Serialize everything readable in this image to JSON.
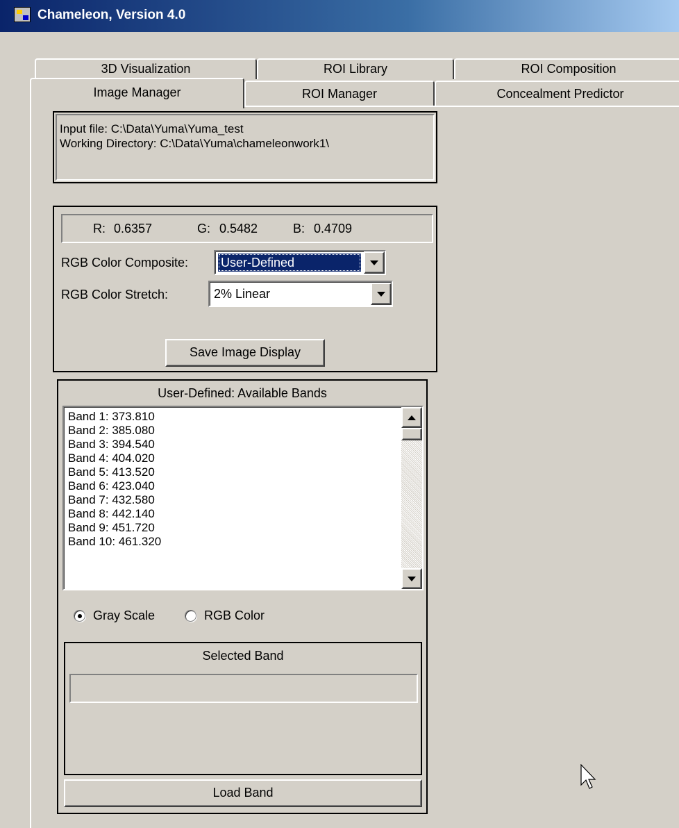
{
  "window": {
    "title": "Chameleon, Version 4.0",
    "icon": "app-icon"
  },
  "tabs": {
    "back_row": [
      "3D Visualization",
      "ROI Library",
      "ROI Composition"
    ],
    "front_row": [
      "Image Manager",
      "ROI Manager",
      "Concealment Predictor"
    ],
    "active": "Image Manager"
  },
  "file_info": {
    "input_file": "Input file: C:\\Data\\Yuma\\Yuma_test",
    "working_directory": "Working Directory: C:\\Data\\Yuma\\chameleonwork1\\"
  },
  "rgb_readout": {
    "r_label": "R:",
    "r_value": "0.6357",
    "g_label": "G:",
    "g_value": "0.5482",
    "b_label": "B:",
    "b_value": "0.4709"
  },
  "composite": {
    "label": "RGB Color Composite:",
    "value": "User-Defined"
  },
  "stretch": {
    "label": "RGB Color Stretch:",
    "value": "2% Linear"
  },
  "save_button": "Save Image Display",
  "bands": {
    "title": "User-Defined: Available Bands",
    "items": [
      "Band 1: 373.810",
      "Band 2: 385.080",
      "Band 3: 394.540",
      "Band 4: 404.020",
      "Band 5: 413.520",
      "Band 6: 423.040",
      "Band 7: 432.580",
      "Band 8: 442.140",
      "Band 9: 451.720",
      "Band 10: 461.320"
    ]
  },
  "mode": {
    "gray_label": "Gray Scale",
    "rgb_label": "RGB Color",
    "selected": "Gray Scale"
  },
  "selected_band": {
    "title": "Selected Band",
    "value": ""
  },
  "load_button": "Load Band",
  "colors": {
    "face": "#d4d0c8",
    "title_start": "#0a246a",
    "highlight": "#0a246a"
  }
}
